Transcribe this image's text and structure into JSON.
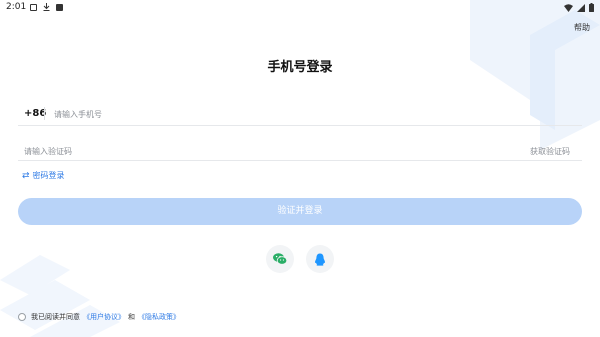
{
  "status_bar": {
    "time": "2:01",
    "left_icons": [
      "image-icon",
      "download-icon",
      "app-a-icon"
    ],
    "right_icons": [
      "wifi-icon",
      "signal-icon",
      "battery-icon"
    ]
  },
  "header": {
    "help": "帮助"
  },
  "title": "手机号登录",
  "phone": {
    "country_code": "+86",
    "placeholder": "请输入手机号",
    "value": ""
  },
  "code": {
    "placeholder": "请输入验证码",
    "value": "",
    "get_code": "获取验证码"
  },
  "switch_login": {
    "label": "密码登录",
    "icon": "swap-icon"
  },
  "submit": {
    "label": "验证并登录",
    "color": "#b8d3f8"
  },
  "social": [
    {
      "name": "wechat",
      "icon": "wechat-icon",
      "color": "#2aae67"
    },
    {
      "name": "qq",
      "icon": "qq-icon",
      "color": "#1e96ff"
    }
  ],
  "agreement": {
    "prefix": "我已阅读并同意",
    "user_agreement": "《用户协议》",
    "and": "和",
    "privacy_policy": "《隐私政策》"
  },
  "colors": {
    "accent": "#2f7be5",
    "placeholder": "#8c9097",
    "divider": "#e6e8eb"
  }
}
